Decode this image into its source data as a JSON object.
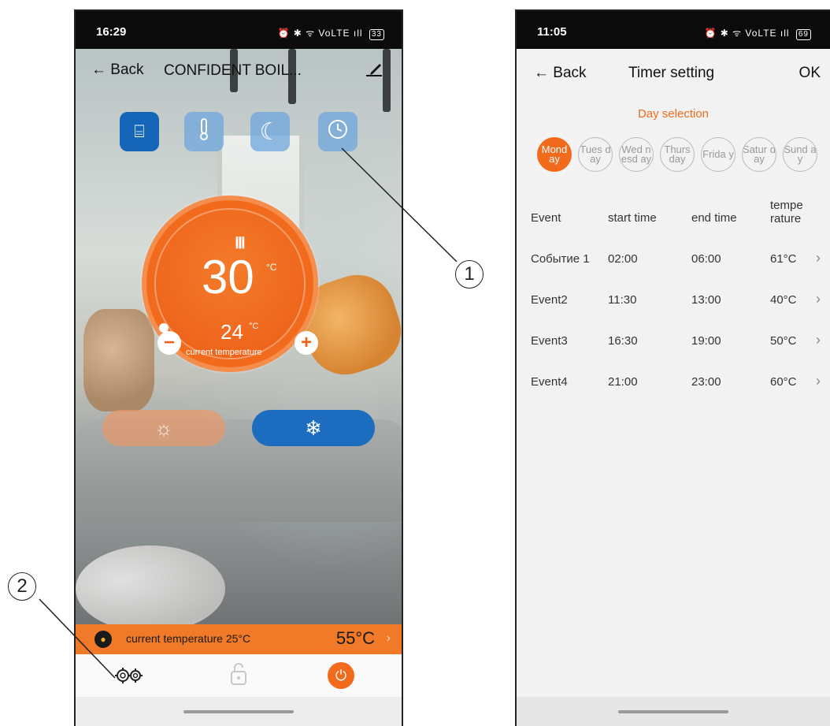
{
  "left_phone": {
    "status": {
      "time": "16:29",
      "icons": "⏰ ✱ ᯤ VoLTE ıll",
      "battery": "33"
    },
    "header": {
      "back_label": "← Back",
      "title": "CONFIDENT BOIL...",
      "edit_icon": "pencil-icon"
    },
    "mode_buttons": [
      {
        "name": "radiator-mode",
        "glyph": "⌸",
        "active": true
      },
      {
        "name": "thermometer-mode",
        "glyph": "🌡",
        "active": false
      },
      {
        "name": "night-mode",
        "glyph": "☾",
        "active": false
      },
      {
        "name": "timer-mode",
        "glyph": "◷",
        "active": false
      }
    ],
    "dial": {
      "radiator_glyph": "Ⅲ",
      "set_temperature": "30",
      "set_unit": "°C",
      "current_temperature": "24",
      "current_unit": "°C",
      "current_label": "current temperature",
      "minus": "−",
      "plus": "+"
    },
    "mode_pills": {
      "heat_glyph": "☼",
      "cool_glyph": "❄"
    },
    "info_bar": {
      "text": "current temperature 25°C",
      "value": "55°C",
      "chevron": "›"
    },
    "bottom": {
      "settings_glyph": "⚙⚙",
      "lock_glyph": "🔓",
      "power_glyph": "⏻"
    },
    "colors": {
      "accent": "#f26b1d",
      "primary_blue": "#1565b8"
    }
  },
  "callouts": {
    "one": "1",
    "two": "2"
  },
  "right_phone": {
    "status": {
      "time": "11:05",
      "icons": "⏰ ✱ ᯤ VoLTE ıll",
      "battery": "69"
    },
    "header": {
      "back_label": "← Back",
      "title": "Timer setting",
      "ok_label": "OK"
    },
    "day_selection_label": "Day selection",
    "days": [
      {
        "label": "Mond ay",
        "active": true
      },
      {
        "label": "Tues day",
        "active": false
      },
      {
        "label": "Wed nesd ay",
        "active": false
      },
      {
        "label": "Thurs day",
        "active": false
      },
      {
        "label": "Frida y",
        "active": false
      },
      {
        "label": "Satur day",
        "active": false
      },
      {
        "label": "Sund ay",
        "active": false
      }
    ],
    "table": {
      "headers": {
        "event": "Event",
        "start": "start time",
        "end": "end time",
        "temp_line1": "tempe",
        "temp_line2": "rature"
      },
      "rows": [
        {
          "event": "Событие 1",
          "start": "02:00",
          "end": "06:00",
          "temp": "61°C"
        },
        {
          "event": "Event2",
          "start": "11:30",
          "end": "13:00",
          "temp": "40°C"
        },
        {
          "event": "Event3",
          "start": "16:30",
          "end": "19:00",
          "temp": "50°C"
        },
        {
          "event": "Event4",
          "start": "21:00",
          "end": "23:00",
          "temp": "60°C"
        }
      ],
      "chevron": "›"
    }
  }
}
